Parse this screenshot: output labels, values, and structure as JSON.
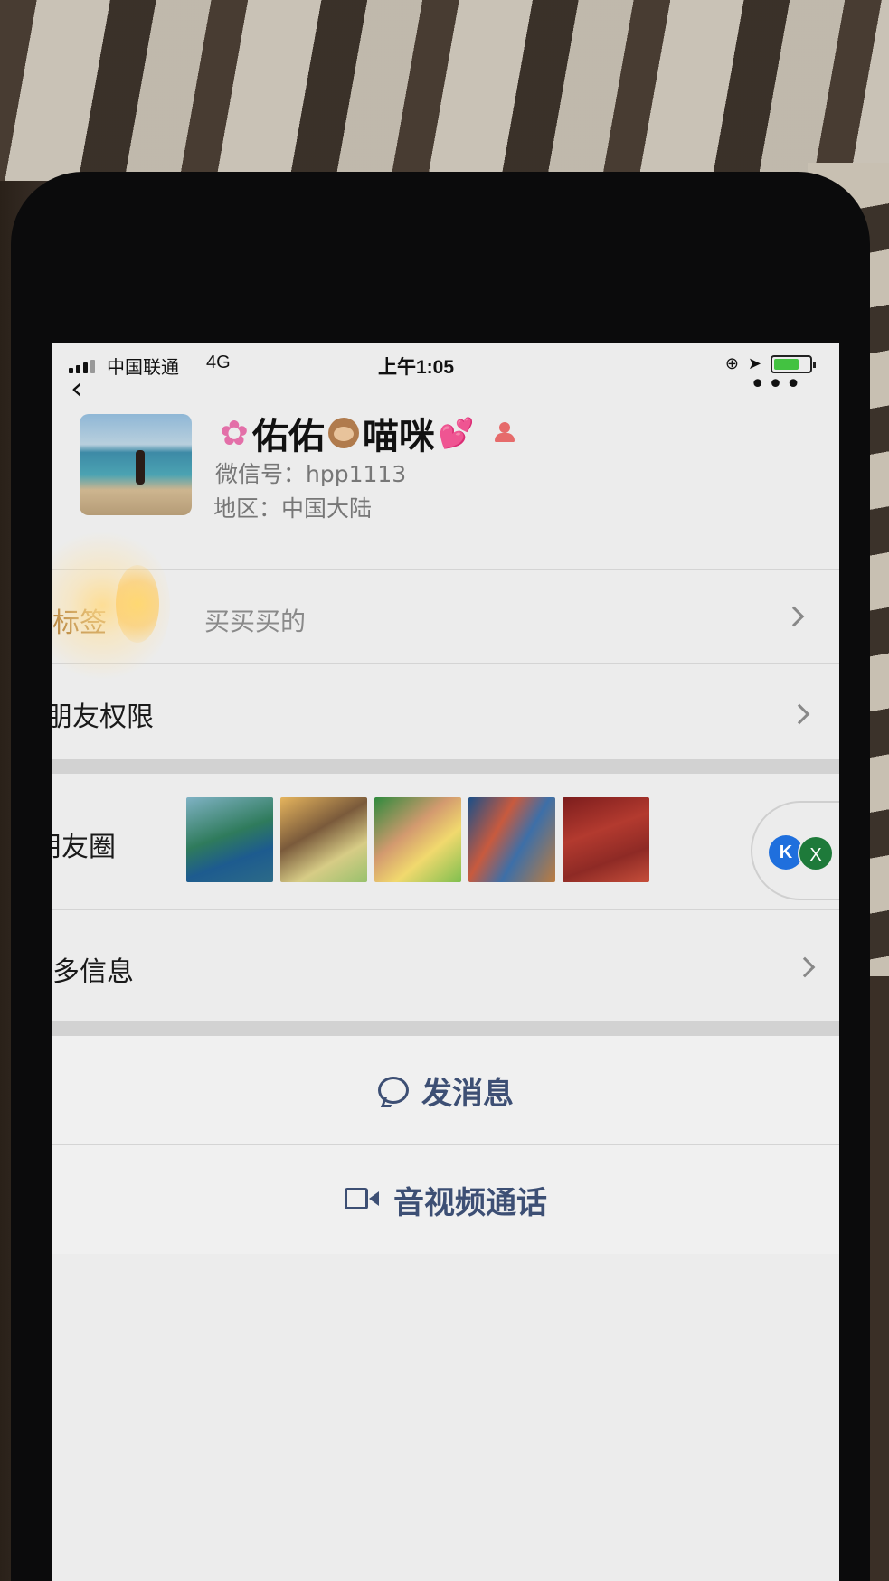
{
  "status_bar": {
    "carrier": "中国联通",
    "network": "4G",
    "time": "上午1:05",
    "battery_level": 0.7
  },
  "nav": {
    "back_icon": "chevron-left-icon",
    "more_icon": "more-dots-icon",
    "more_label": "•••"
  },
  "profile": {
    "name_part1": "佑佑",
    "name_part2": "喵咪",
    "wechat_id": "微信号：hpp1113",
    "region": "地区：中国大陆",
    "gender_icon": "female-icon"
  },
  "rows": {
    "tag_label": "标签",
    "tag_value": "买买买的",
    "permissions_label": "朋友权限",
    "moments_label": "朋友圈",
    "more_info_label": "更多信息"
  },
  "overlay": {
    "left_badge": "K",
    "right_badge": "X"
  },
  "actions": {
    "message_label": "发消息",
    "call_label": "音视频通话"
  },
  "colors": {
    "tag_label": "#a2691f",
    "action_text": "#3d4f74",
    "screen_bg": "#ececec"
  }
}
